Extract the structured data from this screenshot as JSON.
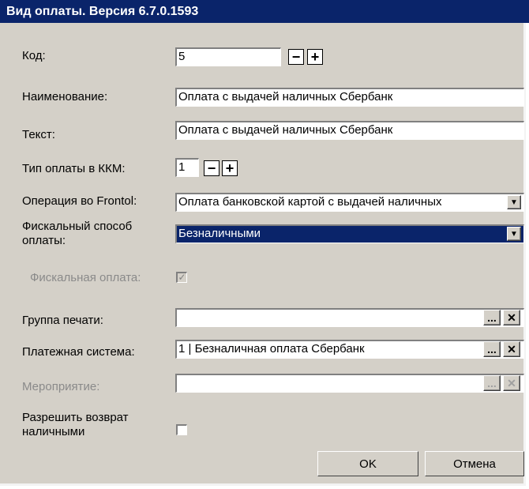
{
  "window": {
    "title": "Вид оплаты. Версия 6.7.0.1593"
  },
  "labels": {
    "code": "Код:",
    "name": "Наименование:",
    "text": "Текст:",
    "kkm_type": "Тип оплаты в ККМ:",
    "frontol_op": "Операция во Frontol:",
    "fiscal_method": "Фискальный способ оплаты:",
    "fiscal_payment": "Фискальная оплата:",
    "print_group": "Группа печати:",
    "payment_system": "Платежная система:",
    "event": "Мероприятие:",
    "allow_cash_return": "Разрешить возврат наличными"
  },
  "values": {
    "code": "5",
    "name": "Оплата с выдачей наличных Сбербанк",
    "text": "Оплата с выдачей наличных Сбербанк",
    "kkm_type": "1",
    "frontol_op": "Оплата банковской картой с выдачей наличных",
    "fiscal_method": "Безналичными",
    "print_group": "",
    "payment_system": "1 | Безналичная оплата Сбербанк",
    "event": ""
  },
  "checks": {
    "fiscal_payment": true,
    "allow_cash_return": false
  },
  "glyphs": {
    "minus": "−",
    "plus": "+",
    "dropdown": "▼",
    "ellipsis": "...",
    "clear": "✕",
    "check": "✓"
  },
  "buttons": {
    "ok": "OK",
    "cancel": "Отмена"
  }
}
